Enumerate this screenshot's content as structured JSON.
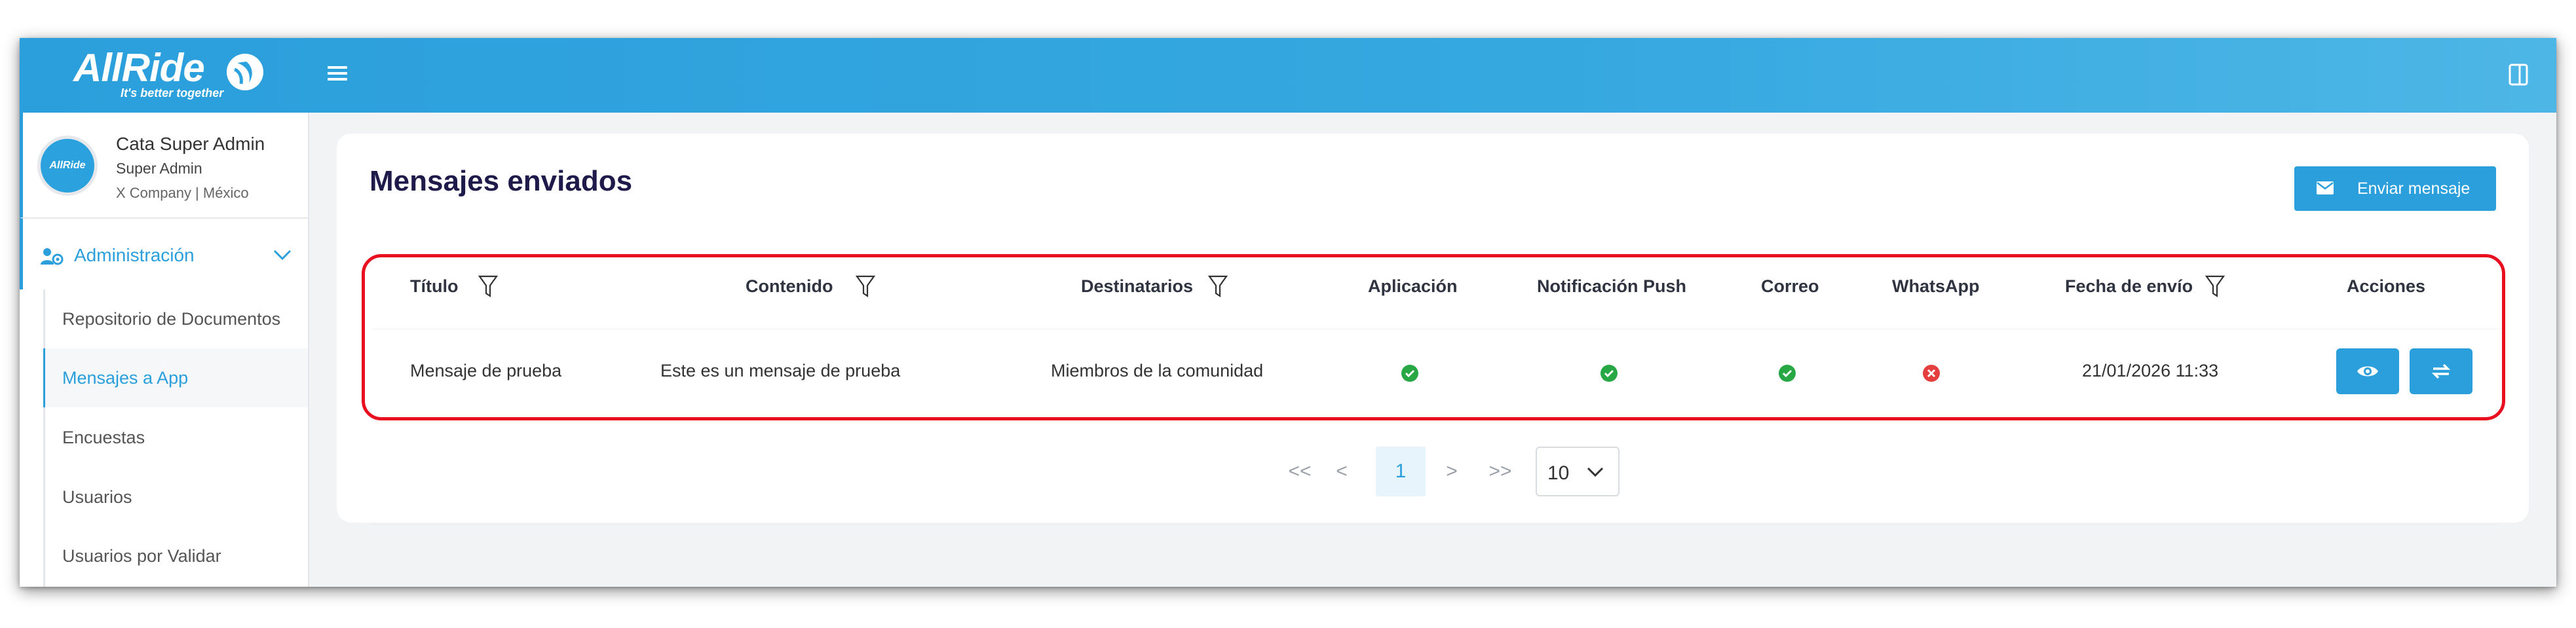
{
  "brand": {
    "name": "AllRide",
    "tagline": "It's better together",
    "avatar_text": "AllRide",
    "accent_color": "#2b9fdb"
  },
  "header": {
    "menu_icon": "hamburger-icon",
    "panel_icon": "panel-toggle-icon"
  },
  "profile": {
    "name": "Cata Super Admin",
    "role": "Super Admin",
    "company": "X Company | México"
  },
  "sidebar": {
    "section": {
      "label": "Administración",
      "icon": "users-gear-icon",
      "expanded": true
    },
    "items": [
      {
        "label": "Repositorio de Documentos",
        "active": false
      },
      {
        "label": "Mensajes a App",
        "active": true
      },
      {
        "label": "Encuestas",
        "active": false
      },
      {
        "label": "Usuarios",
        "active": false
      },
      {
        "label": "Usuarios por Validar",
        "active": false
      }
    ]
  },
  "main": {
    "title": "Mensajes enviados",
    "send_button_label": "Enviar mensaje",
    "send_button_icon": "envelope-icon",
    "table": {
      "columns": [
        "Título",
        "Contenido",
        "Destinatarios",
        "Aplicación",
        "Notificación Push",
        "Correo",
        "WhatsApp",
        "Fecha de envío",
        "Acciones"
      ],
      "rows": [
        {
          "titulo": "Mensaje de prueba",
          "contenido": "Este es un mensaje de prueba",
          "destinatarios": "Miembros de la comunidad",
          "aplicacion": "sent",
          "push": "sent",
          "correo": "sent",
          "whatsapp": "failed",
          "fecha": "21/01/2026 11:33",
          "actions": [
            "eye-icon",
            "resend-icon"
          ]
        }
      ]
    },
    "pagination": {
      "first": "<<",
      "prev": "<",
      "current": "1",
      "next": ">",
      "last": ">>",
      "page_size": "10"
    },
    "status_colors": {
      "sent": "#28a745",
      "failed": "#e53e3e"
    },
    "highlight_color": "#e8101e"
  }
}
